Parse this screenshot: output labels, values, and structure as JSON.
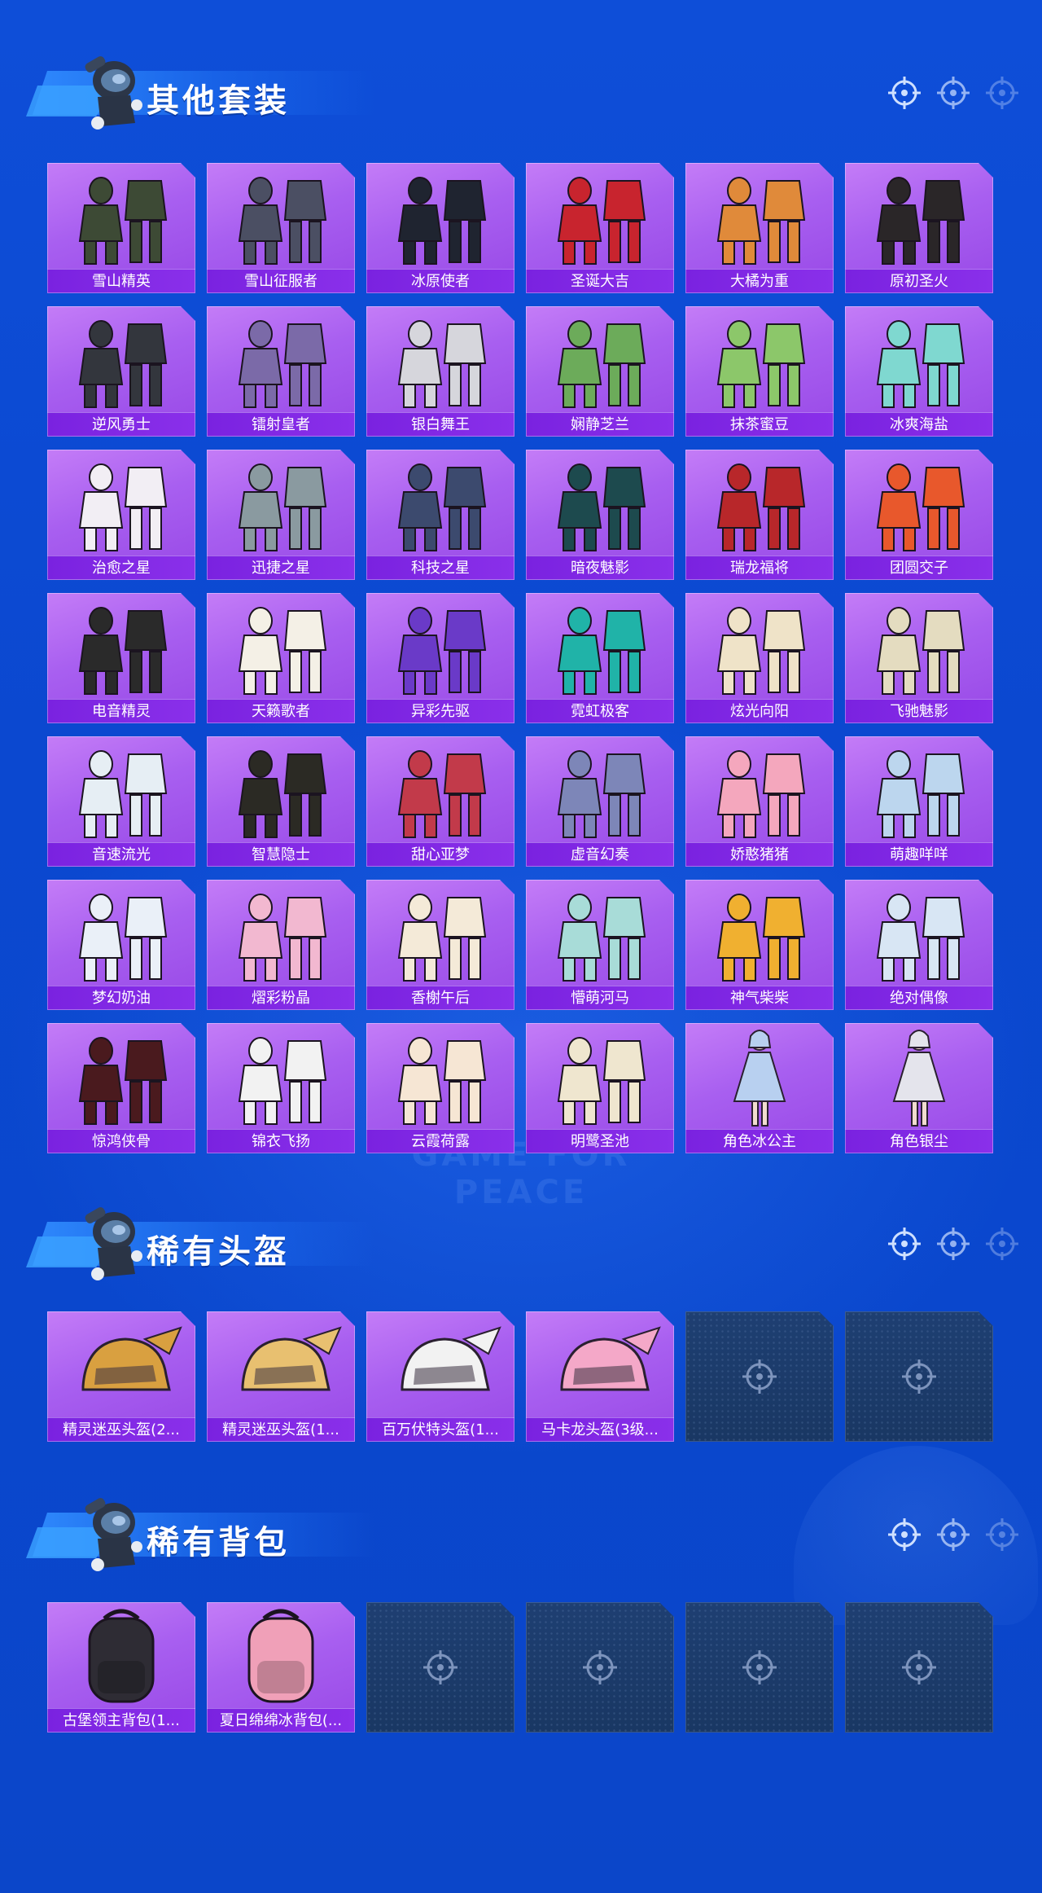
{
  "sections": {
    "other_suits": {
      "title": "其他套装",
      "items": [
        {
          "name": "雪山精英",
          "icon": "outfit-icon",
          "color": "#3d4a35"
        },
        {
          "name": "雪山征服者",
          "icon": "outfit-icon",
          "color": "#4b4f63"
        },
        {
          "name": "冰原使者",
          "icon": "outfit-icon",
          "color": "#1f2430"
        },
        {
          "name": "圣诞大吉",
          "icon": "outfit-icon",
          "color": "#c8242e"
        },
        {
          "name": "大橘为重",
          "icon": "outfit-icon",
          "color": "#e08a3a"
        },
        {
          "name": "原初圣火",
          "icon": "outfit-icon",
          "color": "#2a2628"
        },
        {
          "name": "逆风勇士",
          "icon": "outfit-icon",
          "color": "#33363d"
        },
        {
          "name": "镭射皇者",
          "icon": "outfit-icon",
          "color": "#7b6aa8"
        },
        {
          "name": "银白舞王",
          "icon": "outfit-icon",
          "color": "#d6d6dc"
        },
        {
          "name": "娴静芝兰",
          "icon": "outfit-icon",
          "color": "#6cab5a"
        },
        {
          "name": "抹茶蜜豆",
          "icon": "outfit-icon",
          "color": "#8cc76a"
        },
        {
          "name": "冰爽海盐",
          "icon": "outfit-icon",
          "color": "#7fd8d0"
        },
        {
          "name": "治愈之星",
          "icon": "outfit-icon",
          "color": "#f2eef4"
        },
        {
          "name": "迅捷之星",
          "icon": "outfit-icon",
          "color": "#8a9aa0"
        },
        {
          "name": "科技之星",
          "icon": "outfit-icon",
          "color": "#3c4a6e"
        },
        {
          "name": "暗夜魅影",
          "icon": "outfit-icon",
          "color": "#1d4a4e"
        },
        {
          "name": "瑞龙福将",
          "icon": "outfit-icon",
          "color": "#b8272a"
        },
        {
          "name": "团圆交子",
          "icon": "outfit-icon",
          "color": "#e8582c"
        },
        {
          "name": "电音精灵",
          "icon": "outfit-icon",
          "color": "#2a2a2a"
        },
        {
          "name": "天籁歌者",
          "icon": "outfit-icon",
          "color": "#f4f0e6"
        },
        {
          "name": "异彩先驱",
          "icon": "outfit-icon",
          "color": "#6a3ac8"
        },
        {
          "name": "霓虹极客",
          "icon": "outfit-icon",
          "color": "#20b3a8"
        },
        {
          "name": "炫光向阳",
          "icon": "outfit-icon",
          "color": "#efe3c8"
        },
        {
          "name": "飞驰魅影",
          "icon": "outfit-icon",
          "color": "#e4dcc0"
        },
        {
          "name": "音速流光",
          "icon": "outfit-icon",
          "color": "#e6eef4"
        },
        {
          "name": "智慧隐士",
          "icon": "outfit-icon",
          "color": "#2b2a24"
        },
        {
          "name": "甜心亚梦",
          "icon": "outfit-icon",
          "color": "#c23a4a"
        },
        {
          "name": "虚音幻奏",
          "icon": "outfit-icon",
          "color": "#7d86b8"
        },
        {
          "name": "娇憨猪猪",
          "icon": "outfit-icon",
          "color": "#f4a7bd"
        },
        {
          "name": "萌趣咩咩",
          "icon": "outfit-icon",
          "color": "#bcd6ee"
        },
        {
          "name": "梦幻奶油",
          "icon": "outfit-icon",
          "color": "#eaf0f8"
        },
        {
          "name": "熠彩粉晶",
          "icon": "outfit-icon",
          "color": "#f2b8d0"
        },
        {
          "name": "香榭午后",
          "icon": "outfit-icon",
          "color": "#f4ead8"
        },
        {
          "name": "懵萌河马",
          "icon": "outfit-icon",
          "color": "#a8dcd8"
        },
        {
          "name": "神气柴柴",
          "icon": "outfit-icon",
          "color": "#f0b030"
        },
        {
          "name": "绝对偶像",
          "icon": "outfit-icon",
          "color": "#d8e6f4"
        },
        {
          "name": "惊鸿侠骨",
          "icon": "outfit-icon",
          "color": "#4a1a1e"
        },
        {
          "name": "锦衣飞扬",
          "icon": "outfit-icon",
          "color": "#f2f2f2"
        },
        {
          "name": "云霞荷露",
          "icon": "outfit-icon",
          "color": "#f6e6d4"
        },
        {
          "name": "明鹭圣池",
          "icon": "outfit-icon",
          "color": "#efe6cf"
        },
        {
          "name": "角色冰公主",
          "icon": "character-icon",
          "color": "#b8d0f0"
        },
        {
          "name": "角色银尘",
          "icon": "character-icon",
          "color": "#e4e4ec"
        }
      ]
    },
    "rare_helmets": {
      "title": "稀有头盔",
      "items": [
        {
          "name": "精灵迷巫头盔(2...",
          "icon": "helmet-icon",
          "color": "#d9a040"
        },
        {
          "name": "精灵迷巫头盔(1...",
          "icon": "helmet-icon",
          "color": "#e8c070"
        },
        {
          "name": "百万伏特头盔(1...",
          "icon": "helmet-icon",
          "color": "#f2f2f2"
        },
        {
          "name": "马卡龙头盔(3级...",
          "icon": "helmet-icon",
          "color": "#f4a8c8"
        },
        {
          "name": "",
          "icon": "empty-slot-icon",
          "color": ""
        },
        {
          "name": "",
          "icon": "empty-slot-icon",
          "color": ""
        }
      ]
    },
    "rare_backpacks": {
      "title": "稀有背包",
      "items": [
        {
          "name": "古堡领主背包(1...",
          "icon": "backpack-icon",
          "color": "#2e2c34"
        },
        {
          "name": "夏日绵绵冰背包(...",
          "icon": "backpack-icon",
          "color": "#f0a0b8"
        },
        {
          "name": "",
          "icon": "empty-slot-icon",
          "color": ""
        },
        {
          "name": "",
          "icon": "empty-slot-icon",
          "color": ""
        },
        {
          "name": "",
          "icon": "empty-slot-icon",
          "color": ""
        },
        {
          "name": "",
          "icon": "empty-slot-icon",
          "color": ""
        }
      ]
    }
  },
  "watermark": "GAME FOR PEACE"
}
